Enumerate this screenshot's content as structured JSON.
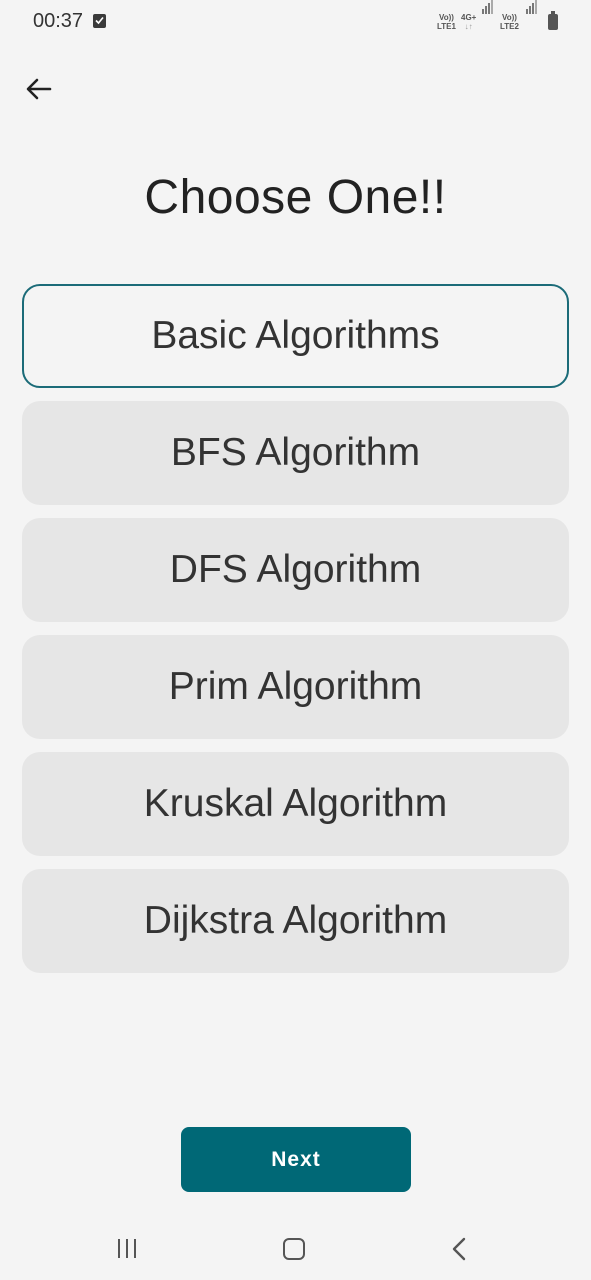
{
  "status_bar": {
    "time": "00:37",
    "sim1_top": "Vo))",
    "sim1_bottom": "LTE1",
    "net_top": "4G+",
    "net_bottom": "↓↑",
    "sim2_top": "Vo))",
    "sim2_bottom": "LTE2",
    "icons": [
      "checkbox-notification-icon",
      "signal-icon",
      "battery-icon"
    ]
  },
  "header": {
    "back_icon": "arrow-left-icon"
  },
  "page": {
    "title": "Choose One!!"
  },
  "options": [
    {
      "label": "Basic Algorithms",
      "selected": true
    },
    {
      "label": "BFS Algorithm",
      "selected": false
    },
    {
      "label": "DFS Algorithm",
      "selected": false
    },
    {
      "label": "Prim Algorithm",
      "selected": false
    },
    {
      "label": "Kruskal Algorithm",
      "selected": false
    },
    {
      "label": "Dijkstra Algorithm",
      "selected": false
    }
  ],
  "actions": {
    "next_label": "Next"
  },
  "colors": {
    "accent": "#006876",
    "selected_border": "#1b6b78",
    "option_bg": "#e6e6e6",
    "page_bg": "#f4f4f4"
  },
  "nav_bar": {
    "icons": [
      "recent-apps-icon",
      "home-icon",
      "back-icon"
    ]
  }
}
